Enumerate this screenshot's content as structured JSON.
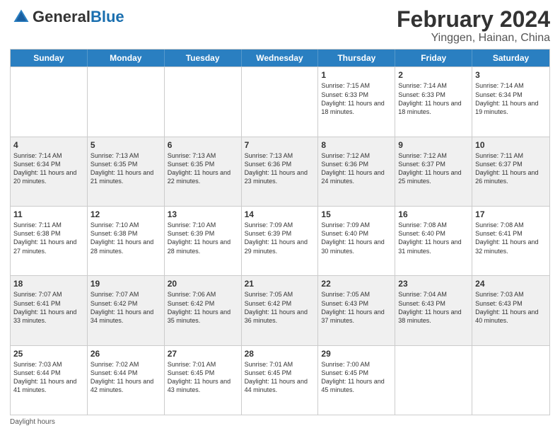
{
  "header": {
    "logo_general": "General",
    "logo_blue": "Blue",
    "month_title": "February 2024",
    "location": "Yinggen, Hainan, China"
  },
  "days_of_week": [
    "Sunday",
    "Monday",
    "Tuesday",
    "Wednesday",
    "Thursday",
    "Friday",
    "Saturday"
  ],
  "weeks": [
    [
      {
        "day": "",
        "info": ""
      },
      {
        "day": "",
        "info": ""
      },
      {
        "day": "",
        "info": ""
      },
      {
        "day": "",
        "info": ""
      },
      {
        "day": "1",
        "info": "Sunrise: 7:15 AM\nSunset: 6:33 PM\nDaylight: 11 hours and 18 minutes."
      },
      {
        "day": "2",
        "info": "Sunrise: 7:14 AM\nSunset: 6:33 PM\nDaylight: 11 hours and 18 minutes."
      },
      {
        "day": "3",
        "info": "Sunrise: 7:14 AM\nSunset: 6:34 PM\nDaylight: 11 hours and 19 minutes."
      }
    ],
    [
      {
        "day": "4",
        "info": "Sunrise: 7:14 AM\nSunset: 6:34 PM\nDaylight: 11 hours and 20 minutes."
      },
      {
        "day": "5",
        "info": "Sunrise: 7:13 AM\nSunset: 6:35 PM\nDaylight: 11 hours and 21 minutes."
      },
      {
        "day": "6",
        "info": "Sunrise: 7:13 AM\nSunset: 6:35 PM\nDaylight: 11 hours and 22 minutes."
      },
      {
        "day": "7",
        "info": "Sunrise: 7:13 AM\nSunset: 6:36 PM\nDaylight: 11 hours and 23 minutes."
      },
      {
        "day": "8",
        "info": "Sunrise: 7:12 AM\nSunset: 6:36 PM\nDaylight: 11 hours and 24 minutes."
      },
      {
        "day": "9",
        "info": "Sunrise: 7:12 AM\nSunset: 6:37 PM\nDaylight: 11 hours and 25 minutes."
      },
      {
        "day": "10",
        "info": "Sunrise: 7:11 AM\nSunset: 6:37 PM\nDaylight: 11 hours and 26 minutes."
      }
    ],
    [
      {
        "day": "11",
        "info": "Sunrise: 7:11 AM\nSunset: 6:38 PM\nDaylight: 11 hours and 27 minutes."
      },
      {
        "day": "12",
        "info": "Sunrise: 7:10 AM\nSunset: 6:38 PM\nDaylight: 11 hours and 28 minutes."
      },
      {
        "day": "13",
        "info": "Sunrise: 7:10 AM\nSunset: 6:39 PM\nDaylight: 11 hours and 28 minutes."
      },
      {
        "day": "14",
        "info": "Sunrise: 7:09 AM\nSunset: 6:39 PM\nDaylight: 11 hours and 29 minutes."
      },
      {
        "day": "15",
        "info": "Sunrise: 7:09 AM\nSunset: 6:40 PM\nDaylight: 11 hours and 30 minutes."
      },
      {
        "day": "16",
        "info": "Sunrise: 7:08 AM\nSunset: 6:40 PM\nDaylight: 11 hours and 31 minutes."
      },
      {
        "day": "17",
        "info": "Sunrise: 7:08 AM\nSunset: 6:41 PM\nDaylight: 11 hours and 32 minutes."
      }
    ],
    [
      {
        "day": "18",
        "info": "Sunrise: 7:07 AM\nSunset: 6:41 PM\nDaylight: 11 hours and 33 minutes."
      },
      {
        "day": "19",
        "info": "Sunrise: 7:07 AM\nSunset: 6:42 PM\nDaylight: 11 hours and 34 minutes."
      },
      {
        "day": "20",
        "info": "Sunrise: 7:06 AM\nSunset: 6:42 PM\nDaylight: 11 hours and 35 minutes."
      },
      {
        "day": "21",
        "info": "Sunrise: 7:05 AM\nSunset: 6:42 PM\nDaylight: 11 hours and 36 minutes."
      },
      {
        "day": "22",
        "info": "Sunrise: 7:05 AM\nSunset: 6:43 PM\nDaylight: 11 hours and 37 minutes."
      },
      {
        "day": "23",
        "info": "Sunrise: 7:04 AM\nSunset: 6:43 PM\nDaylight: 11 hours and 38 minutes."
      },
      {
        "day": "24",
        "info": "Sunrise: 7:03 AM\nSunset: 6:43 PM\nDaylight: 11 hours and 40 minutes."
      }
    ],
    [
      {
        "day": "25",
        "info": "Sunrise: 7:03 AM\nSunset: 6:44 PM\nDaylight: 11 hours and 41 minutes."
      },
      {
        "day": "26",
        "info": "Sunrise: 7:02 AM\nSunset: 6:44 PM\nDaylight: 11 hours and 42 minutes."
      },
      {
        "day": "27",
        "info": "Sunrise: 7:01 AM\nSunset: 6:45 PM\nDaylight: 11 hours and 43 minutes."
      },
      {
        "day": "28",
        "info": "Sunrise: 7:01 AM\nSunset: 6:45 PM\nDaylight: 11 hours and 44 minutes."
      },
      {
        "day": "29",
        "info": "Sunrise: 7:00 AM\nSunset: 6:45 PM\nDaylight: 11 hours and 45 minutes."
      },
      {
        "day": "",
        "info": ""
      },
      {
        "day": "",
        "info": ""
      }
    ]
  ],
  "footer": "Daylight hours"
}
